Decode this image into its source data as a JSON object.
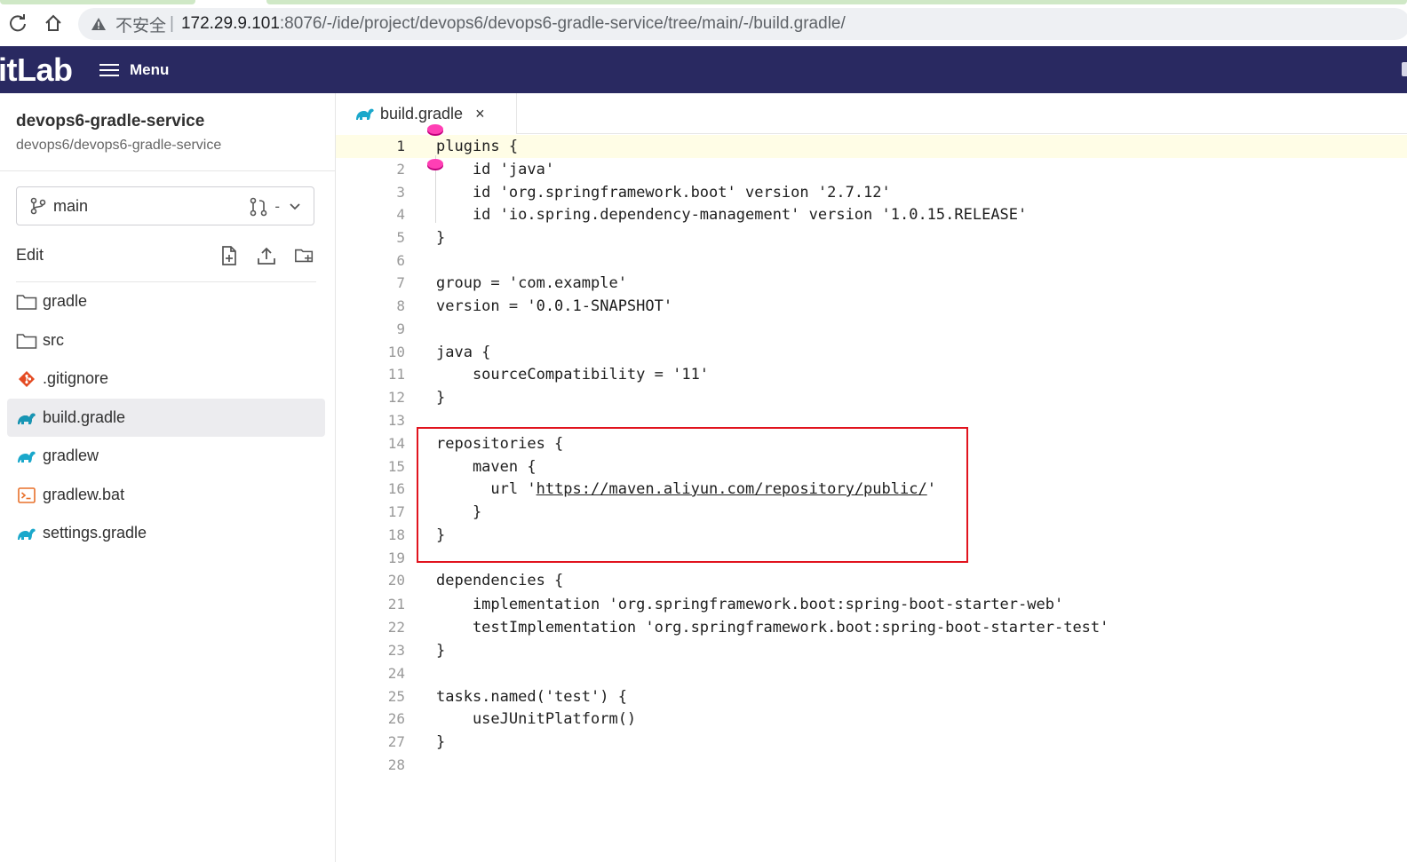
{
  "browser": {
    "insecure_label": "不安全",
    "separator": "|",
    "url_host": "172.29.9.101",
    "url_rest": ":8076/-/ide/project/devops6/devops6-gradle-service/tree/main/-/build.gradle/"
  },
  "header": {
    "logo_text": "itLab",
    "menu_label": "Menu",
    "bg_color": "#292961"
  },
  "sidebar": {
    "project_name": "devops6-gradle-service",
    "project_path": "devops6/devops6-gradle-service",
    "branch": "main",
    "mr_indicator": "-",
    "edit_label": "Edit",
    "files": [
      {
        "name": "gradle",
        "icon": "folder-icon"
      },
      {
        "name": "src",
        "icon": "folder-icon"
      },
      {
        "name": ".gitignore",
        "icon": "git-icon"
      },
      {
        "name": "build.gradle",
        "icon": "gradle-elephant-icon",
        "active": true
      },
      {
        "name": "gradlew",
        "icon": "gradle-elephant-icon"
      },
      {
        "name": "gradlew.bat",
        "icon": "terminal-icon"
      },
      {
        "name": "settings.gradle",
        "icon": "gradle-elephant-icon"
      }
    ]
  },
  "editor": {
    "tab_name": "build.gradle",
    "tab_close": "×",
    "current_line": 1,
    "lines": [
      "plugins {",
      "    id 'java'",
      "    id 'org.springframework.boot' version '2.7.12'",
      "    id 'io.spring.dependency-management' version '1.0.15.RELEASE'",
      "}",
      "",
      "group = 'com.example'",
      "version = '0.0.1-SNAPSHOT'",
      "",
      "java {",
      "    sourceCompatibility = '11'",
      "}",
      "",
      "repositories {",
      "    maven {",
      "      url 'https://maven.aliyun.com/repository/public/'",
      "    }",
      "}",
      "",
      "dependencies {",
      "    implementation 'org.springframework.boot:spring-boot-starter-web'",
      "    testImplementation 'org.springframework.boot:spring-boot-starter-test'",
      "}",
      "",
      "tasks.named('test') {",
      "    useJUnitPlatform()",
      "}",
      ""
    ],
    "link_text": "https://maven.aliyun.com/repository/public/",
    "highlight_color": "#e1141e"
  }
}
